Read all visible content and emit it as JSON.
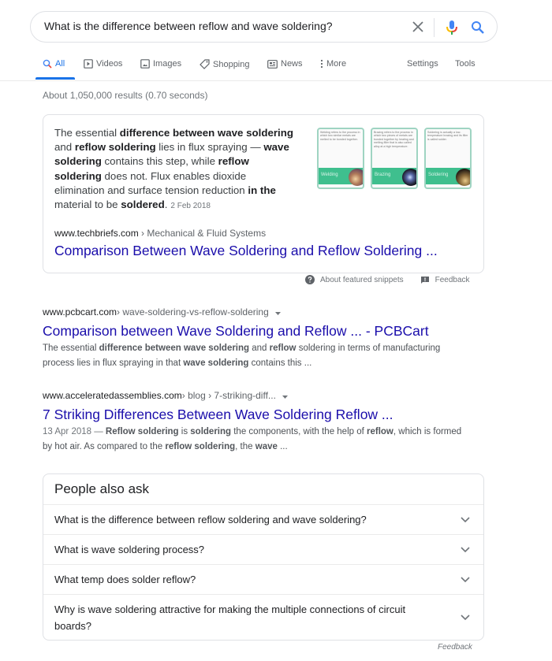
{
  "search": {
    "query": "What is the difference between reflow and wave soldering?",
    "icons": [
      "close-icon",
      "mic-icon",
      "search-icon"
    ]
  },
  "tabs": [
    {
      "label": "All",
      "icon": "search-icon",
      "active": true
    },
    {
      "label": "Videos",
      "icon": "play-icon"
    },
    {
      "label": "Images",
      "icon": "image-icon"
    },
    {
      "label": "Shopping",
      "icon": "tag-icon"
    },
    {
      "label": "News",
      "icon": "newspaper-icon"
    },
    {
      "label": "More",
      "icon": "more-vert-icon"
    }
  ],
  "tools": {
    "settings": "Settings",
    "tools": "Tools"
  },
  "stats": "About 1,050,000 results (0.70 seconds)",
  "featured_snippet": {
    "text_parts": [
      {
        "t": "The essential ",
        "b": false
      },
      {
        "t": "difference between wave soldering",
        "b": true
      },
      {
        "t": " and ",
        "b": false
      },
      {
        "t": "reflow soldering",
        "b": true
      },
      {
        "t": " lies in flux spraying — ",
        "b": false
      },
      {
        "t": "wave soldering",
        "b": true
      },
      {
        "t": " contains this step, while ",
        "b": false
      },
      {
        "t": "reflow soldering",
        "b": true
      },
      {
        "t": " does not. Flux enables dioxide elimination and surface tension reduction ",
        "b": false
      },
      {
        "t": "in the",
        "b": true
      },
      {
        "t": " material to be ",
        "b": false
      },
      {
        "t": "soldered",
        "b": true
      },
      {
        "t": ".",
        "b": false
      }
    ],
    "date": "2 Feb 2018",
    "cards": [
      {
        "caption": "Welding refers to the process in which two similar metals are melted to be bonded together.",
        "label": "Welding"
      },
      {
        "caption": "Brazing refers to the process in which two pieces of metals are bonded together by heating and melting filler that is also called alloy at a high temperature.",
        "label": "Brazing"
      },
      {
        "caption": "Soldering is actually a low-temperature brazing and its filler is called solder.",
        "label": "Soldering"
      }
    ],
    "cite_domain": "www.techbriefs.com",
    "cite_path": " › Mechanical & Fluid Systems",
    "link_title": "Comparison Between Wave Soldering and Reflow Soldering ...",
    "about_label": "About featured snippets",
    "feedback_label": "Feedback"
  },
  "results": [
    {
      "domain": "www.pcbcart.com",
      "path": " › wave-soldering-vs-reflow-soldering",
      "title": "Comparison between Wave Soldering and Reflow ... - PCBCart",
      "date": "",
      "desc_parts": [
        {
          "t": "The essential ",
          "b": false
        },
        {
          "t": "difference between wave soldering",
          "b": true
        },
        {
          "t": " and ",
          "b": false
        },
        {
          "t": "reflow",
          "b": true
        },
        {
          "t": " soldering in terms of manufacturing process lies in flux spraying in that ",
          "b": false
        },
        {
          "t": "wave soldering",
          "b": true
        },
        {
          "t": " contains this ...",
          "b": false
        }
      ]
    },
    {
      "domain": "www.acceleratedassemblies.com",
      "path": " › blog › 7-striking-diff...",
      "title": "7 Striking Differences Between Wave Soldering Reflow ...",
      "date": "13 Apr 2018 — ",
      "desc_parts": [
        {
          "t": "Reflow soldering",
          "b": true
        },
        {
          "t": " is ",
          "b": false
        },
        {
          "t": "soldering",
          "b": true
        },
        {
          "t": " the components, with the help of ",
          "b": false
        },
        {
          "t": "reflow",
          "b": true
        },
        {
          "t": ", which is formed by hot air. As compared to the ",
          "b": false
        },
        {
          "t": "reflow soldering",
          "b": true
        },
        {
          "t": ", the ",
          "b": false
        },
        {
          "t": "wave",
          "b": true
        },
        {
          "t": " ...",
          "b": false
        }
      ]
    }
  ],
  "people_also_ask": {
    "title": "People also ask",
    "questions": [
      "What is the difference between reflow soldering and wave soldering?",
      "What is wave soldering process?",
      "What temp does solder reflow?",
      "Why is wave soldering attractive for making the multiple connections of circuit boards?"
    ],
    "feedback_label": "Feedback"
  }
}
